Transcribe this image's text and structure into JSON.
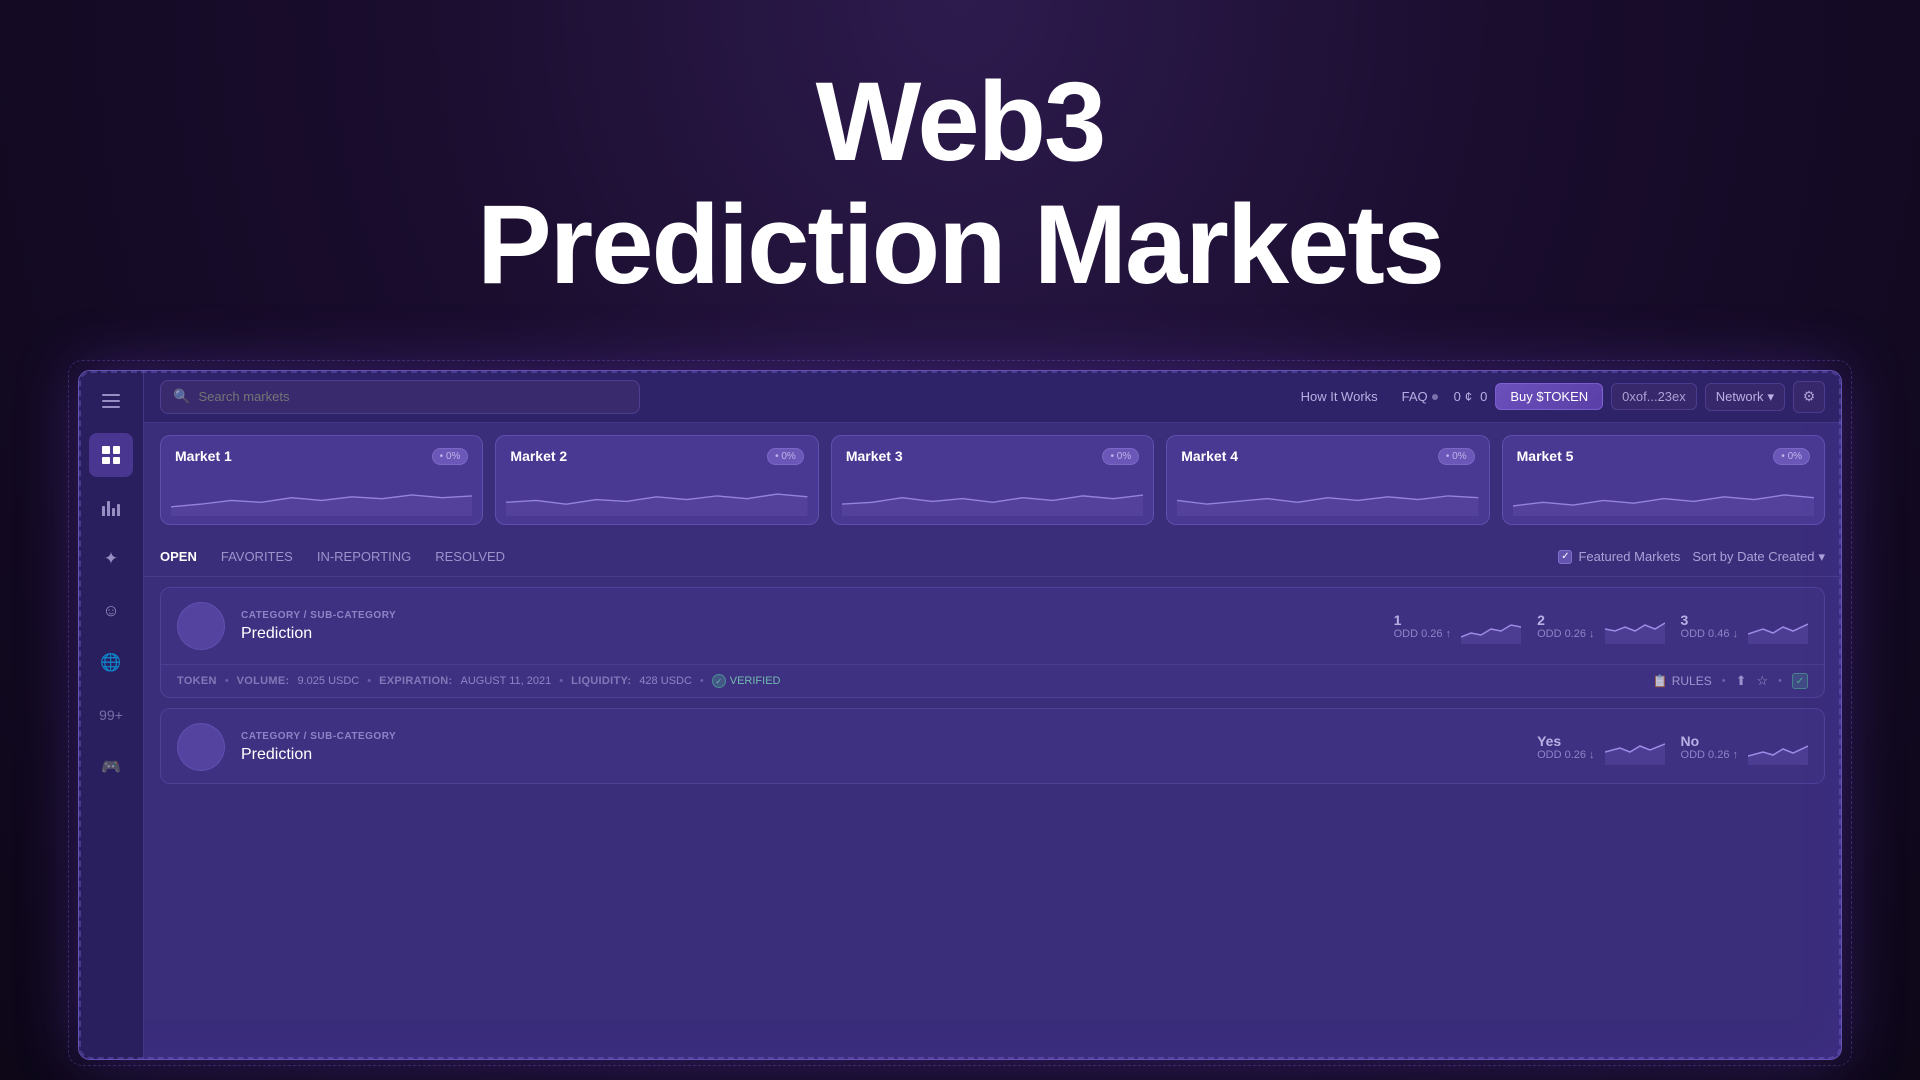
{
  "page": {
    "title": "Web3 Prediction Markets"
  },
  "hero": {
    "line1": "Web3",
    "line2": "Prediction Markets"
  },
  "navbar": {
    "search_placeholder": "Search markets",
    "how_it_works": "How It Works",
    "faq": "FAQ",
    "balance1": "0",
    "currency1": "¢",
    "balance2": "0",
    "buy_token": "Buy $TOKEN",
    "wallet": "0xof...23ex",
    "network": "Network",
    "settings_icon": "⚙"
  },
  "market_cards": [
    {
      "title": "Market 1",
      "badge": "• 0%"
    },
    {
      "title": "Market 2",
      "badge": "• 0%"
    },
    {
      "title": "Market 3",
      "badge": "• 0%"
    },
    {
      "title": "Market 4",
      "badge": "• 0%"
    },
    {
      "title": "Market 5",
      "badge": "• 0%"
    }
  ],
  "tabs": [
    {
      "label": "OPEN",
      "active": true
    },
    {
      "label": "FAVORITES",
      "active": false
    },
    {
      "label": "IN-REPORTING",
      "active": false
    },
    {
      "label": "RESOLVED",
      "active": false
    }
  ],
  "filter": {
    "featured": "Featured Markets",
    "sort": "Sort by Date Created"
  },
  "markets": [
    {
      "category": "CATEGORY / SUB-CATEGORY",
      "title": "Prediction",
      "outcomes": [
        {
          "label": "1",
          "odd": "ODD 0.26 ↑"
        },
        {
          "label": "2",
          "odd": "ODD 0.26 ↓"
        },
        {
          "label": "3",
          "odd": "ODD 0.46 ↓"
        }
      ],
      "footer": {
        "token": "TOKEN",
        "volume_label": "VOLUME:",
        "volume_value": "9.025 USDC",
        "expiration_label": "EXPIRATION:",
        "expiration_value": "AUGUST 11, 2021",
        "liquidity_label": "LIQUIDITY:",
        "liquidity_value": "428 USDC",
        "verified": "VERIFIED",
        "rules": "RULES"
      }
    },
    {
      "category": "CATEGORY / SUB-CATEGORY",
      "title": "Prediction",
      "outcomes": [
        {
          "label": "Yes",
          "odd": "ODD 0.26 ↓"
        },
        {
          "label": "No",
          "odd": "ODD 0.26 ↑"
        }
      ],
      "footer": null
    }
  ],
  "sidebar": {
    "items": [
      {
        "icon": "grid",
        "label": "Dashboard",
        "active": true
      },
      {
        "icon": "bars",
        "label": "Markets"
      },
      {
        "icon": "badge",
        "label": "Rewards"
      },
      {
        "icon": "face",
        "label": "Profile"
      },
      {
        "icon": "globe",
        "label": "Network"
      },
      {
        "icon": "plus",
        "label": "More"
      },
      {
        "icon": "game",
        "label": "Games"
      }
    ]
  }
}
